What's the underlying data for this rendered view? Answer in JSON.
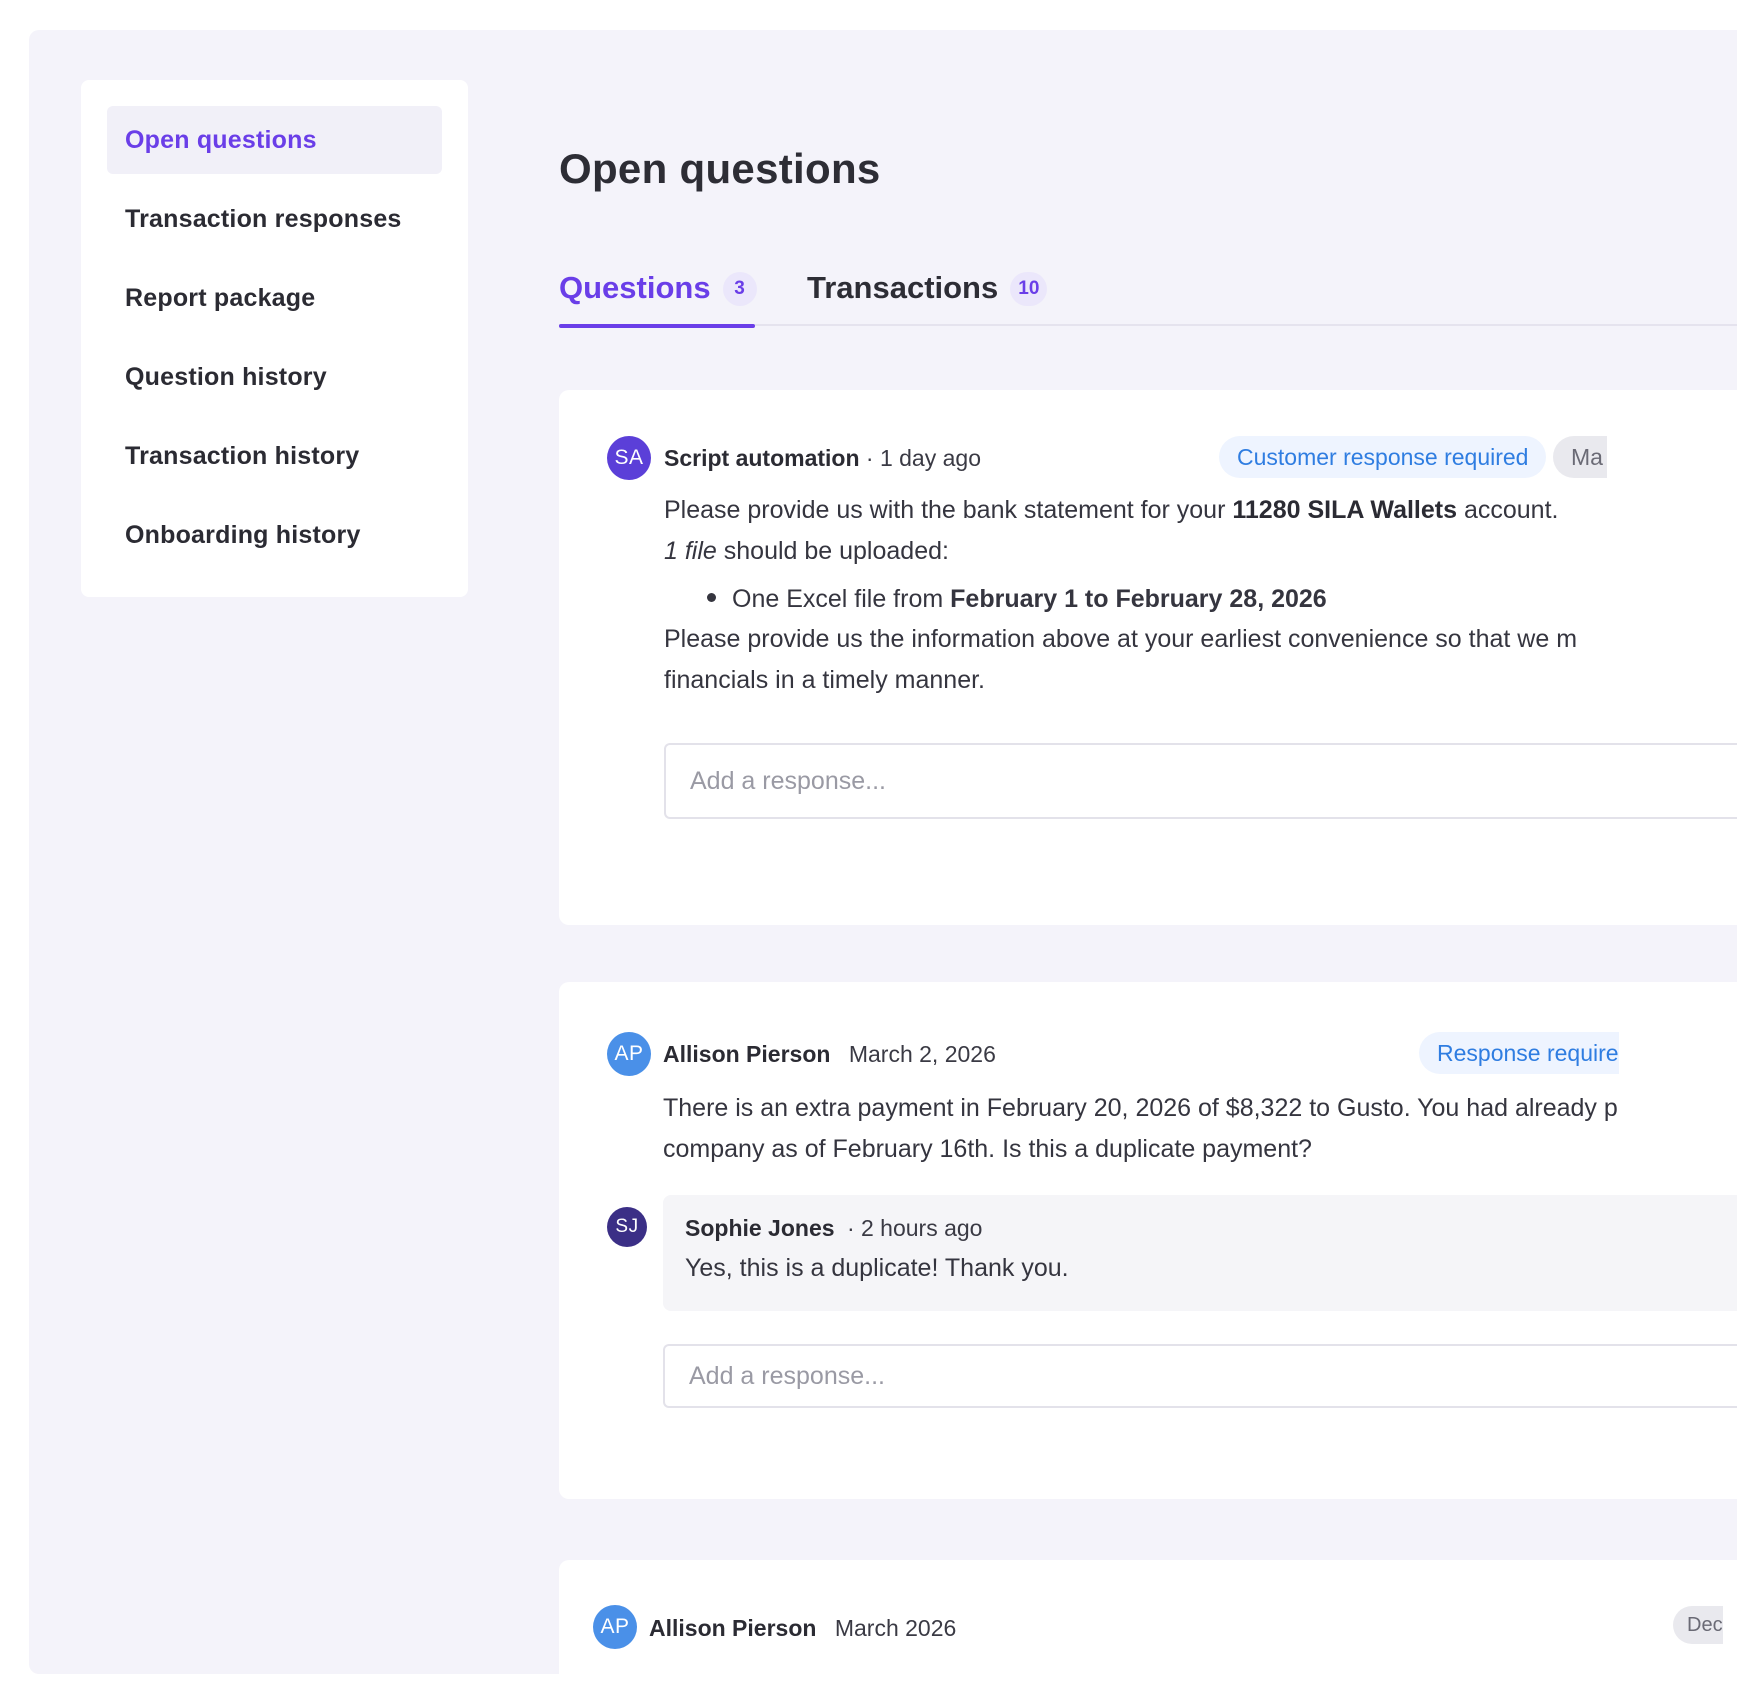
{
  "sidebar": {
    "items": [
      {
        "label": "Open questions"
      },
      {
        "label": "Transaction responses"
      },
      {
        "label": "Report package"
      },
      {
        "label": "Question history"
      },
      {
        "label": "Transaction history"
      },
      {
        "label": "Onboarding history"
      }
    ]
  },
  "page": {
    "title": "Open questions"
  },
  "tabs": [
    {
      "label": "Questions",
      "count": "3"
    },
    {
      "label": "Transactions",
      "count": "10"
    }
  ],
  "questions": [
    {
      "avatar": "SA",
      "author": "Script automation",
      "time": "· 1 day ago",
      "status": "Customer response required",
      "secondary_badge": "Ma",
      "line1_pre": "Please provide us with the bank statement for your ",
      "line1_bold": "11280 SILA Wallets",
      "line1_post": " account.",
      "line2_italic": "1 file",
      "line2_post": " should be uploaded:",
      "bullet_pre": "One Excel file from ",
      "bullet_bold": "February 1 to February 28, 2026",
      "para2_line1": "Please provide us the information above at your earliest convenience so that we m",
      "para2_line2": "financials in a timely manner.",
      "response_placeholder": "Add a response..."
    },
    {
      "avatar": "AP",
      "author": "Allison Pierson",
      "time": "March 2, 2026",
      "status": "Response require",
      "line1": "There is an extra payment in February 20, 2026 of $8,322 to Gusto. You had already p",
      "line2": "company as of February 16th. Is this a duplicate payment?",
      "reply": {
        "avatar": "SJ",
        "author": "Sophie Jones",
        "time": "· 2 hours ago",
        "text": "Yes, this is a duplicate! Thank you."
      },
      "response_placeholder": "Add a response..."
    },
    {
      "avatar": "AP",
      "author": "Allison Pierson",
      "time": "March 2026",
      "secondary_badge": "Dec"
    }
  ]
}
